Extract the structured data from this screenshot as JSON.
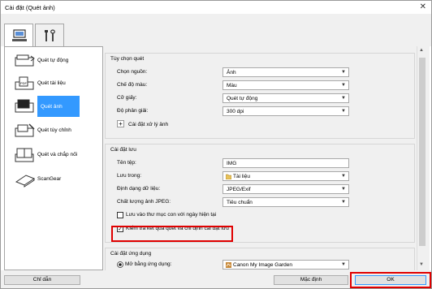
{
  "window": {
    "title": "Cài đặt (Quét ảnh)",
    "close": "✕"
  },
  "tabs": [
    {
      "name": "computer",
      "active": true
    },
    {
      "name": "tools",
      "active": false
    }
  ],
  "sidebar": {
    "items": [
      {
        "label": "Quét tự động"
      },
      {
        "label": "Quét tài liệu"
      },
      {
        "label": "Quét ảnh",
        "selected": true
      },
      {
        "label": "Quét tùy chỉnh"
      },
      {
        "label": "Quét và chắp nối"
      },
      {
        "label": "ScanGear"
      }
    ]
  },
  "scan_options": {
    "title": "Tùy chọn quét",
    "rows": [
      {
        "label": "Chọn nguồn:",
        "value": "Ảnh"
      },
      {
        "label": "Chế độ màu:",
        "value": "Màu"
      },
      {
        "label": "Cỡ giấy:",
        "value": "Quét tự động"
      },
      {
        "label": "Độ phân giải:",
        "value": "300 dpi"
      }
    ],
    "image_processing": "Cài đặt xử lý ảnh",
    "plus": "+"
  },
  "save_settings": {
    "title": "Cài đặt lưu",
    "file_name_label": "Tên tệp:",
    "file_name_value": "IMG",
    "save_in_label": "Lưu trong:",
    "save_in_value": "Tài liệu",
    "format_label": "Định dạng dữ liệu:",
    "format_value": "JPEG/Exif",
    "jpeg_quality_label": "Chất lượng ảnh JPEG:",
    "jpeg_quality_value": "Tiêu chuẩn",
    "subfolder_label": "Lưu vào thư mục con với ngày hiện tại",
    "subfolder_checked": false,
    "check_results_label": "Kiểm tra kết quả quét và chỉ định cài đặt lưu",
    "check_results_checked": true
  },
  "app_settings": {
    "title": "Cài đặt ứng dụng",
    "open_with_label": "Mở bằng ứng dụng:",
    "open_with_value": "Canon My Image Garden"
  },
  "footer": {
    "help": "Chỉ dẫn",
    "defaults": "Mặc định",
    "ok": "OK"
  },
  "colors": {
    "accent": "#3399ff",
    "highlight": "#e00000"
  }
}
